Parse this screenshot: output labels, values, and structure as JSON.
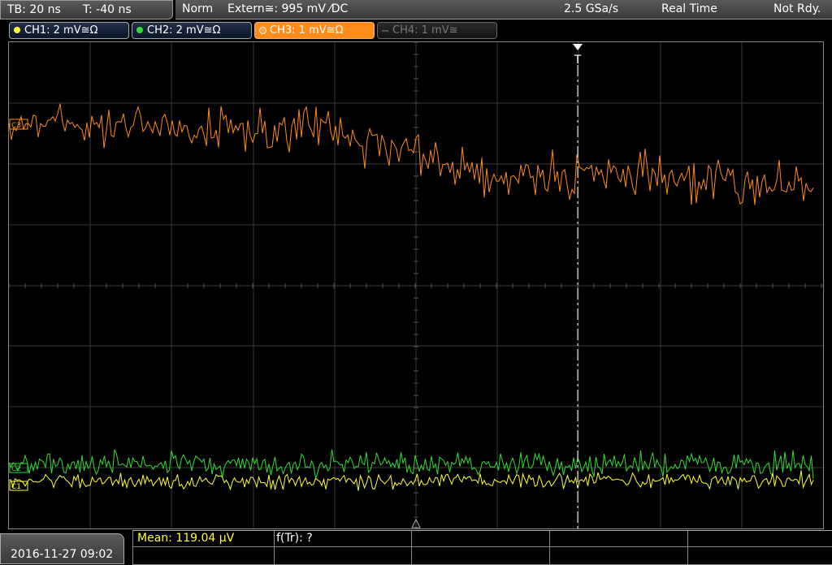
{
  "status": {
    "timebase": "TB: 20 ns",
    "trigger_time": "T: -40 ns",
    "trigger_mode": "Norm",
    "trigger_source": "Extern≅: 995 mV ⁄DC",
    "sample_rate": "2.5 GSa/s",
    "acquisition": "Real Time",
    "run_state": "Not Rdy."
  },
  "channels": [
    {
      "label": "CH1: 2 mV≅Ω",
      "color": "#ffff33",
      "state": "on"
    },
    {
      "label": "CH2: 2 mV≅Ω",
      "color": "#33dd33",
      "state": "on"
    },
    {
      "label": "CH3: 1 mV≅Ω",
      "color": "#ff8c1a",
      "state": "selected"
    },
    {
      "label": "CH4: 1 mV≅",
      "color": "#777777",
      "state": "off"
    }
  ],
  "markers": {
    "trigger": "T",
    "ch3_marker": "C3",
    "ch2_marker": "C2",
    "ch1_marker": "C1"
  },
  "footer": {
    "datetime": "2016-11-27 09:02",
    "mean_label": "Mean: 119.04 µV",
    "ftr_label": "f(Tr): ?"
  },
  "colors": {
    "ch1": "#ffff33",
    "ch2": "#33dd33",
    "ch3": "#ff8c1a",
    "grid": "#3a3a3a"
  }
}
